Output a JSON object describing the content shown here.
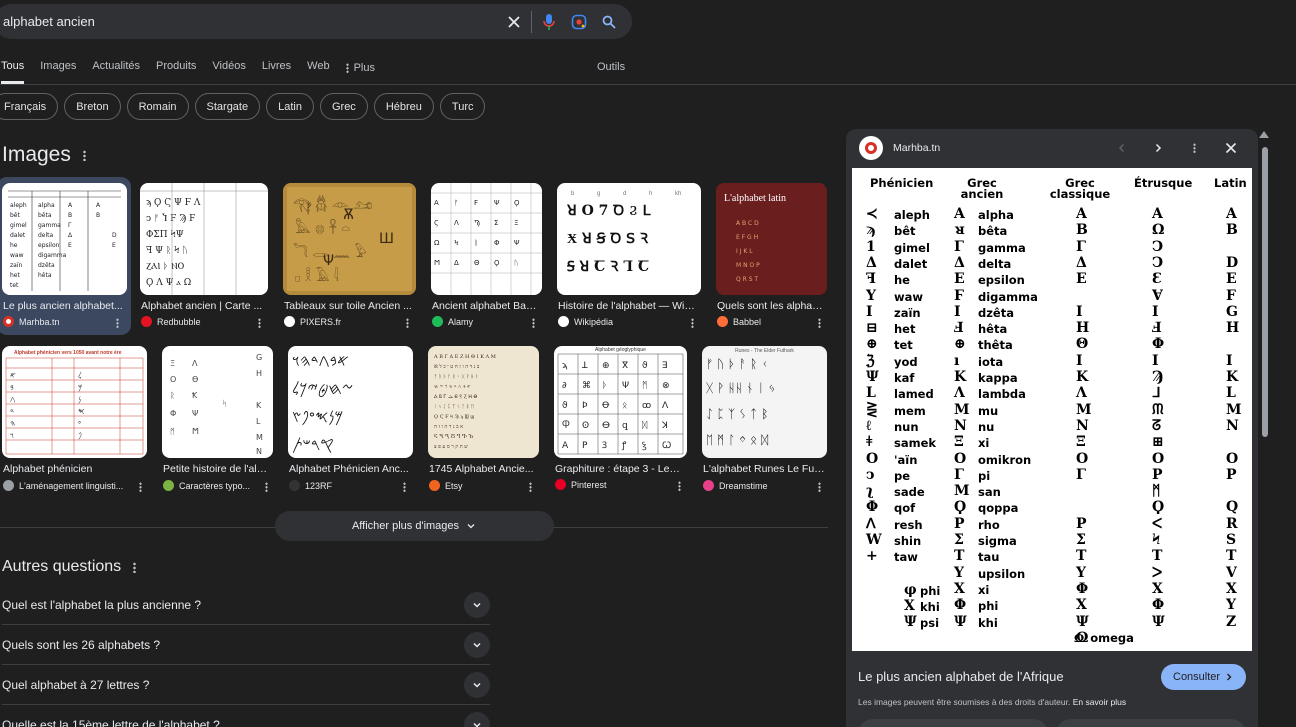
{
  "search": {
    "query": "alphabet ancien"
  },
  "tabs": [
    "Tous",
    "Images",
    "Actualités",
    "Produits",
    "Vidéos",
    "Livres",
    "Web",
    "Plus"
  ],
  "tools_label": "Outils",
  "chips": [
    "Français",
    "Breton",
    "Romain",
    "Stargate",
    "Latin",
    "Grec",
    "Hébreu",
    "Turc"
  ],
  "images_heading": "Images",
  "images_row1": [
    {
      "title": "Le plus ancien alphabet...",
      "source": "Marhba.tn",
      "fav_color": "#d93025"
    },
    {
      "title": "Alphabet ancien | Carte ...",
      "source": "Redbubble",
      "fav_color": "#e41321"
    },
    {
      "title": "Tableaux sur toile Ancien ...",
      "source": "PIXERS.fr",
      "fav_color": "#ffffff"
    },
    {
      "title": "Ancient alphabet Ban...",
      "source": "Alamy",
      "fav_color": "#1fbc5a"
    },
    {
      "title": "Histoire de l'alphabet — Wiki...",
      "source": "Wikipédia",
      "fav_color": "#ffffff"
    },
    {
      "title": "Quels sont les alphab...",
      "source": "Babbel",
      "fav_color": "#ff6d3a"
    }
  ],
  "images_row2": [
    {
      "title": "Alphabet phénicien",
      "source": "L'aménagement linguisti...",
      "fav_color": "#9aa0a6"
    },
    {
      "title": "Petite histoire de l'alp...",
      "source": "Caractères typo...",
      "fav_color": "#7cb342"
    },
    {
      "title": "Alphabet Phénicien Anc...",
      "source": "123RF",
      "fav_color": "#333333"
    },
    {
      "title": "1745 Alphabet Ancie...",
      "source": "Etsy",
      "fav_color": "#f1641e"
    },
    {
      "title": "Graphiture : étape 3 - Les ...",
      "source": "Pinterest",
      "fav_color": "#e60023"
    },
    {
      "title": "L'alphabet Runes Le Fut...",
      "source": "Dreamstime",
      "fav_color": "#e8408a"
    }
  ],
  "thumb_texts": {
    "babbel_title": "L'alphabet latin",
    "phen_header": "Alphabet phénicien vers 1050 avant notre ère",
    "runes_header": "Runes - The Elder Futhark",
    "graphiture_header": "Alphabet géoglyphique"
  },
  "show_more": "Afficher plus d'images",
  "questions_heading": "Autres questions",
  "questions": [
    "Quel est l'alphabet la plus ancienne ?",
    "Quels sont les 26 alphabets ?",
    "Quel alphabet à 27 lettres ?",
    "Quelle est la 15ème lettre de l'alphabet ?"
  ],
  "panel": {
    "site": "Marhba.tn",
    "title": "Le plus ancien alphabet de l'Afrique",
    "consult": "Consulter",
    "note": "Les images peuvent être soumises à des droits d'auteur.",
    "note_link": "En savoir plus"
  },
  "alphabet_table": {
    "headers": [
      "Phénicien",
      "Grec ancien",
      "Grec classique",
      "Étrusque",
      "Latin"
    ],
    "phoenician": [
      "aleph",
      "bêt",
      "gimel",
      "dalet",
      "he",
      "waw",
      "zaïn",
      "het",
      "tet",
      "yod",
      "kaf",
      "lamed",
      "mem",
      "nun",
      "samek",
      "'aïn",
      "pe",
      "sade",
      "qof",
      "resh",
      "shin",
      "taw"
    ],
    "greek_ancient": [
      "alpha",
      "bêta",
      "gamma",
      "delta",
      "epsilon",
      "digamma",
      "dzêta",
      "hêta",
      "thêta",
      "iota",
      "kappa",
      "lambda",
      "mu",
      "nu",
      "xi",
      "omikron",
      "pi",
      "san",
      "qoppa",
      "rho",
      "sigma",
      "tau",
      "upsilon",
      "xi",
      "phi",
      "khi"
    ],
    "extra_left": [
      "phi",
      "khi",
      "psi"
    ],
    "omega": "omega",
    "classic": [
      "Α",
      "Β",
      "Γ",
      "Δ",
      "Ε",
      "",
      "Ι",
      "Η",
      "Θ",
      "Ι",
      "Κ",
      "Λ",
      "Μ",
      "Ν",
      "Ξ",
      "Ο",
      "Γ",
      "",
      "",
      "Ρ",
      "Σ",
      "Τ",
      "Υ",
      "Φ",
      "Χ",
      "Ψ",
      "Ω"
    ],
    "latin": [
      "A",
      "B",
      "",
      "D",
      "E",
      "F",
      "G",
      "H",
      "",
      "I",
      "K",
      "L",
      "M",
      "N",
      "",
      "O",
      "P",
      "",
      "Q",
      "R",
      "S",
      "T",
      "V",
      "X",
      "Y",
      "Z"
    ]
  }
}
